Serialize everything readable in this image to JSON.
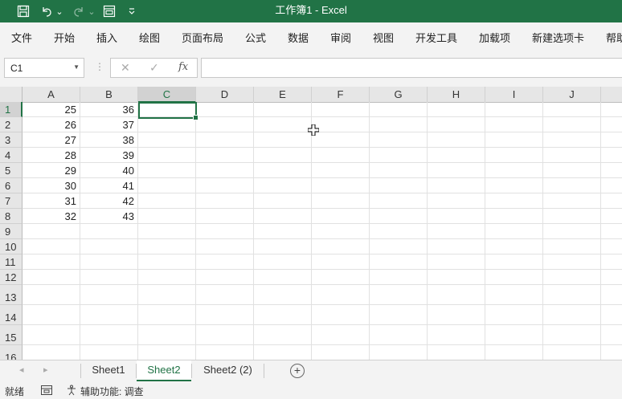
{
  "window": {
    "title": "工作簿1  -  Excel"
  },
  "quick_access": {
    "icons": [
      "save-icon",
      "undo-icon",
      "redo-icon",
      "form-icon",
      "customize-icon"
    ],
    "dropdown_glyph": "⌄"
  },
  "ribbon_tabs": [
    "文件",
    "开始",
    "插入",
    "绘图",
    "页面布局",
    "公式",
    "数据",
    "审阅",
    "视图",
    "开发工具",
    "加载项",
    "新建选项卡",
    "帮助"
  ],
  "formula_bar": {
    "name_box": "C1",
    "cancel_glyph": "✕",
    "enter_glyph": "✓",
    "fx_label": "fx",
    "formula": ""
  },
  "columns": [
    "A",
    "B",
    "C",
    "D",
    "E",
    "F",
    "G",
    "H",
    "I",
    "J"
  ],
  "rows": [
    "1",
    "2",
    "3",
    "4",
    "5",
    "6",
    "7",
    "8",
    "9",
    "10",
    "11",
    "12",
    "13",
    "14",
    "15",
    "16"
  ],
  "cells": {
    "A": [
      "25",
      "26",
      "27",
      "28",
      "29",
      "30",
      "31",
      "32"
    ],
    "B": [
      "36",
      "37",
      "38",
      "39",
      "40",
      "41",
      "42",
      "43"
    ]
  },
  "selected_cell": {
    "column": "C",
    "row": "1"
  },
  "sheet_tabs": [
    {
      "label": "Sheet1",
      "active": false
    },
    {
      "label": "Sheet2",
      "active": true
    },
    {
      "label": "Sheet2 (2)",
      "active": false
    }
  ],
  "sheet_nav": {
    "prev": "◂",
    "next": "▸",
    "add": "+"
  },
  "status": {
    "ready": "就绪",
    "accessibility": "辅助功能: 调查"
  },
  "colors": {
    "accent": "#217346",
    "grid": "#e1e1e1",
    "header": "#e6e6e6"
  }
}
